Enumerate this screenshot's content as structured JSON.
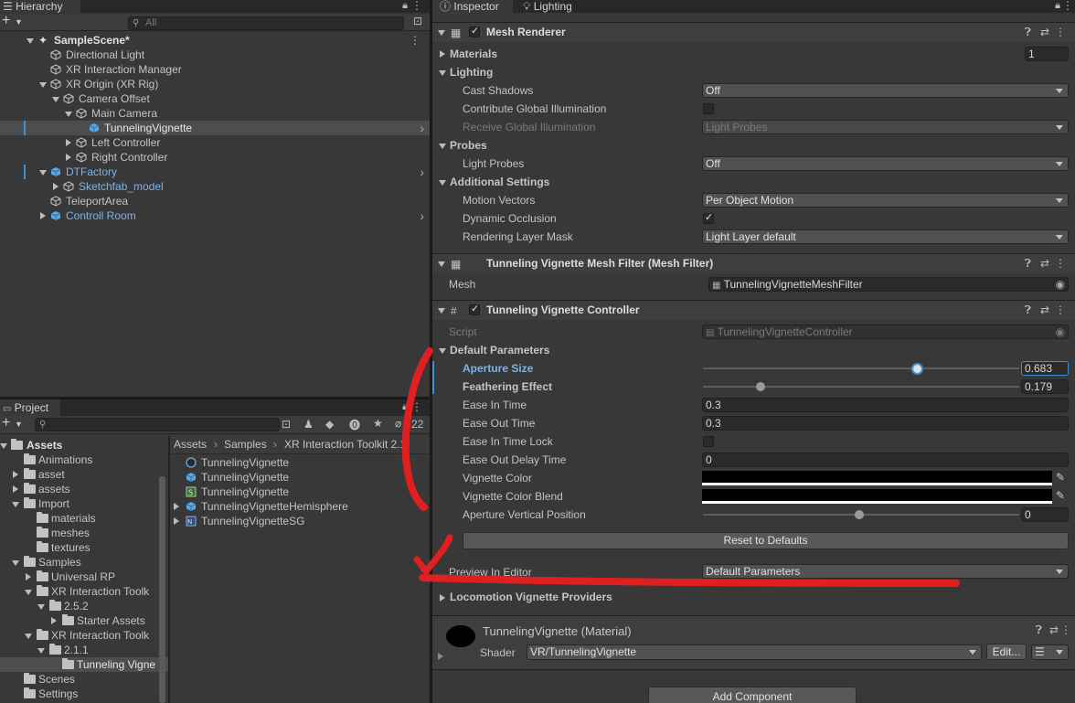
{
  "hierarchy": {
    "tab_label": "Hierarchy",
    "search_placeholder": "All",
    "items": [
      {
        "label": "SampleScene*"
      },
      {
        "label": "Directional Light"
      },
      {
        "label": "XR Interaction Manager"
      },
      {
        "label": "XR Origin (XR Rig)"
      },
      {
        "label": "Camera Offset"
      },
      {
        "label": "Main Camera"
      },
      {
        "label": "TunnelingVignette"
      },
      {
        "label": "Left Controller"
      },
      {
        "label": "Right Controller"
      },
      {
        "label": "DTFactory"
      },
      {
        "label": "Sketchfab_model"
      },
      {
        "label": "TeleportArea"
      },
      {
        "label": "Controll Room"
      }
    ]
  },
  "project": {
    "tab_label": "Project",
    "badge_count": "22",
    "tree": [
      {
        "label": "Assets"
      },
      {
        "label": "Animations"
      },
      {
        "label": "asset"
      },
      {
        "label": "assets"
      },
      {
        "label": "Import"
      },
      {
        "label": "materials"
      },
      {
        "label": "meshes"
      },
      {
        "label": "textures"
      },
      {
        "label": "Samples"
      },
      {
        "label": "Universal RP"
      },
      {
        "label": "XR Interaction Toolk"
      },
      {
        "label": "2.5.2"
      },
      {
        "label": "Starter Assets"
      },
      {
        "label": "XR Interaction Toolk"
      },
      {
        "label": "2.1.1"
      },
      {
        "label": "Tunneling Vigne"
      },
      {
        "label": "Scenes"
      },
      {
        "label": "Settings"
      }
    ],
    "breadcrumb": [
      "Assets",
      "Samples",
      "XR Interaction Toolkit 2.1"
    ],
    "files": [
      {
        "label": "TunnelingVignette"
      },
      {
        "label": "TunnelingVignette"
      },
      {
        "label": "TunnelingVignette"
      },
      {
        "label": "TunnelingVignetteHemisphere"
      },
      {
        "label": "TunnelingVignetteSG"
      }
    ]
  },
  "inspector": {
    "tab_inspector": "Inspector",
    "tab_lighting": "Lighting",
    "mesh_renderer": {
      "title": "Mesh Renderer",
      "materials_label": "Materials",
      "materials_count": "1",
      "lighting_label": "Lighting",
      "cast_shadows_label": "Cast Shadows",
      "cast_shadows_value": "Off",
      "contribute_gi_label": "Contribute Global Illumination",
      "receive_gi_label": "Receive Global Illumination",
      "receive_gi_value": "Light Probes",
      "probes_label": "Probes",
      "light_probes_label": "Light Probes",
      "light_probes_value": "Off",
      "additional_label": "Additional Settings",
      "motion_vectors_label": "Motion Vectors",
      "motion_vectors_value": "Per Object Motion",
      "dynamic_occlusion_label": "Dynamic Occlusion",
      "rendering_layer_label": "Rendering Layer Mask",
      "rendering_layer_value": "Light Layer default"
    },
    "mesh_filter": {
      "title": "Tunneling Vignette Mesh Filter (Mesh Filter)",
      "mesh_label": "Mesh",
      "mesh_value": "TunnelingVignetteMeshFilter"
    },
    "controller": {
      "title": "Tunneling Vignette Controller",
      "script_label": "Script",
      "script_value": "TunnelingVignetteController",
      "default_params_label": "Default Parameters",
      "aperture_size_label": "Aperture Size",
      "aperture_size_value": "0.683",
      "feathering_label": "Feathering Effect",
      "feathering_value": "0.179",
      "ease_in_label": "Ease In Time",
      "ease_in_value": "0.3",
      "ease_out_label": "Ease Out Time",
      "ease_out_value": "0.3",
      "ease_in_lock_label": "Ease In Time Lock",
      "ease_out_delay_label": "Ease Out Delay Time",
      "ease_out_delay_value": "0",
      "vignette_color_label": "Vignette Color",
      "vignette_color_blend_label": "Vignette Color Blend",
      "aperture_vertical_label": "Aperture Vertical Position",
      "aperture_vertical_value": "0",
      "reset_button": "Reset to Defaults",
      "preview_label": "Preview In Editor",
      "preview_value": "Default Parameters",
      "locomotion_label": "Locomotion Vignette Providers"
    },
    "material": {
      "title": "TunnelingVignette (Material)",
      "shader_label": "Shader",
      "shader_value": "VR/TunnelingVignette",
      "edit_button": "Edit..."
    },
    "add_component_button": "Add Component"
  },
  "colors": {
    "selection": "#2c5d87",
    "annotation": "#e02020",
    "link_blue": "#7cb3ea"
  }
}
